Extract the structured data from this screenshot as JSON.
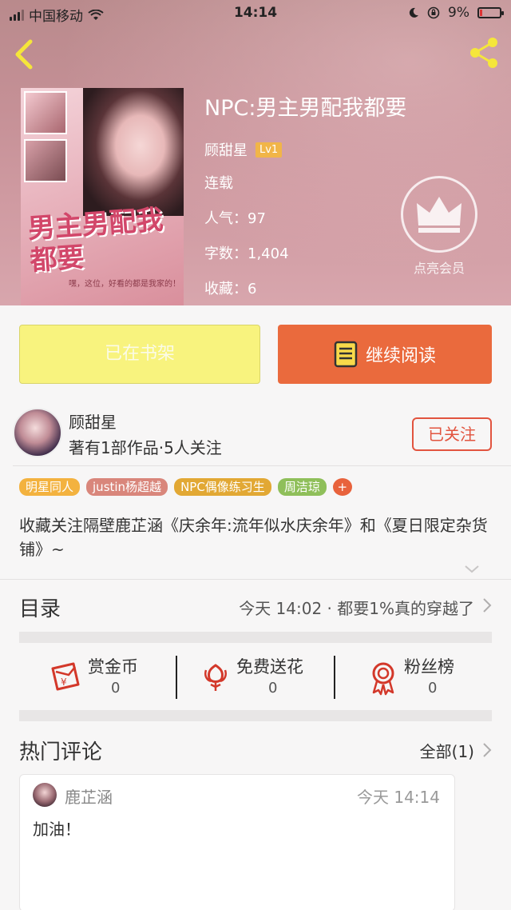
{
  "status_bar": {
    "carrier": "中国移动",
    "time": "14:14",
    "battery": "9%"
  },
  "book": {
    "title": "NPC:男主男配我都要",
    "author": "顾甜星",
    "level": "Lv1",
    "status": "连载",
    "popularity_label": "人气：",
    "popularity": "97",
    "words_label": "字数：",
    "words": "1,404",
    "favorites_label": "收藏：",
    "favorites": "6",
    "cover_title": "男主男配我都要",
    "cover_sub": "嘿，这位，好看的都是我家的！"
  },
  "member": {
    "label": "点亮会员"
  },
  "actions": {
    "shelf_label": "已在书架",
    "read_label": "继续阅读"
  },
  "author_section": {
    "name": "顾甜星",
    "stats": "著有1部作品·5人关注",
    "follow_label": "已关注",
    "tags": [
      {
        "label": "明星同人",
        "color": "#f3b23f"
      },
      {
        "label": "justin杨超越",
        "color": "#d9867b"
      },
      {
        "label": "NPC偶像练习生",
        "color": "#e2a834"
      },
      {
        "label": "周洁琼",
        "color": "#8fbf5a"
      }
    ],
    "tag_add": "+",
    "description": "收藏关注隔壁鹿芷涵《庆余年:流年似水庆余年》和《夏日限定杂货铺》~"
  },
  "catalog": {
    "title": "目录",
    "latest": "今天 14:02 · 都要1%真的穿越了"
  },
  "stats": {
    "reward_label": "赏金币",
    "reward_value": "0",
    "flower_label": "免费送花",
    "flower_value": "0",
    "fans_label": "粉丝榜",
    "fans_value": "0"
  },
  "comments": {
    "title": "热门评论",
    "all_label": "全部(1)",
    "items": [
      {
        "user": "鹿芷涵",
        "time": "今天 14:14",
        "text": "加油！"
      }
    ]
  },
  "colors": {
    "accent": "#ea6a3d",
    "shelf_button": "#f8f37e",
    "follow": "#e2543f",
    "level_badge": "#f1b548"
  }
}
